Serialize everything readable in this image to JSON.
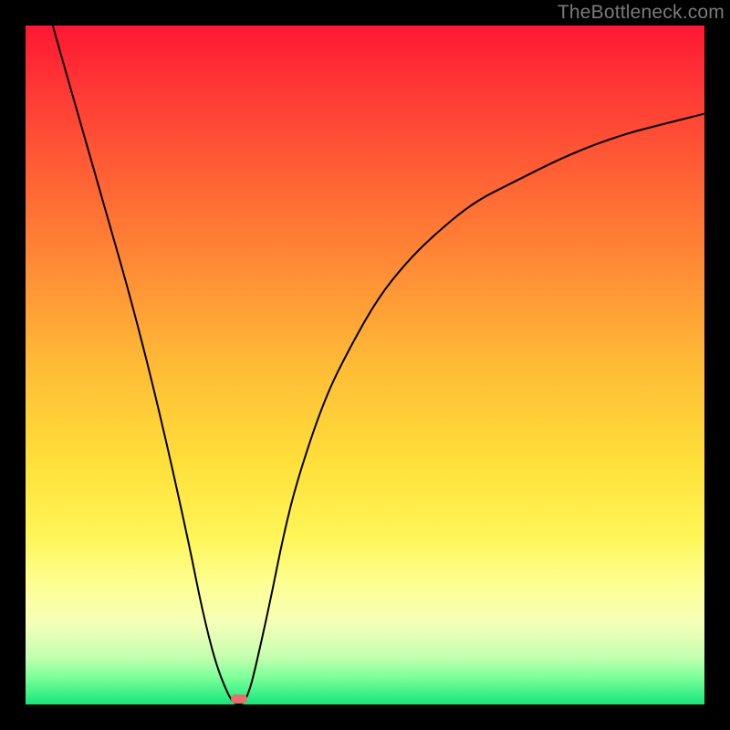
{
  "watermark": "TheBottleneck.com",
  "colors": {
    "frame": "#000000",
    "curve": "#000000",
    "marker": "#e46f6c",
    "gradient_top": "#ff1733",
    "gradient_bottom": "#14e77a"
  },
  "chart_data": {
    "type": "line",
    "title": "",
    "xlabel": "",
    "ylabel": "",
    "xlim": [
      0,
      100
    ],
    "ylim": [
      0,
      100
    ],
    "x": [
      4,
      8,
      12,
      16,
      20,
      24,
      26,
      28,
      30,
      31,
      32,
      33,
      34,
      36,
      38,
      40,
      44,
      48,
      52,
      56,
      60,
      66,
      72,
      80,
      88,
      96,
      100
    ],
    "values": [
      100,
      86,
      72,
      58,
      42,
      24,
      14,
      6,
      1,
      0,
      0,
      2,
      6,
      15,
      25,
      33,
      45,
      53,
      60,
      65,
      69,
      74,
      77,
      81,
      84,
      86,
      87
    ],
    "marker": {
      "x": 31.5,
      "y": 0.8
    },
    "annotations": []
  }
}
